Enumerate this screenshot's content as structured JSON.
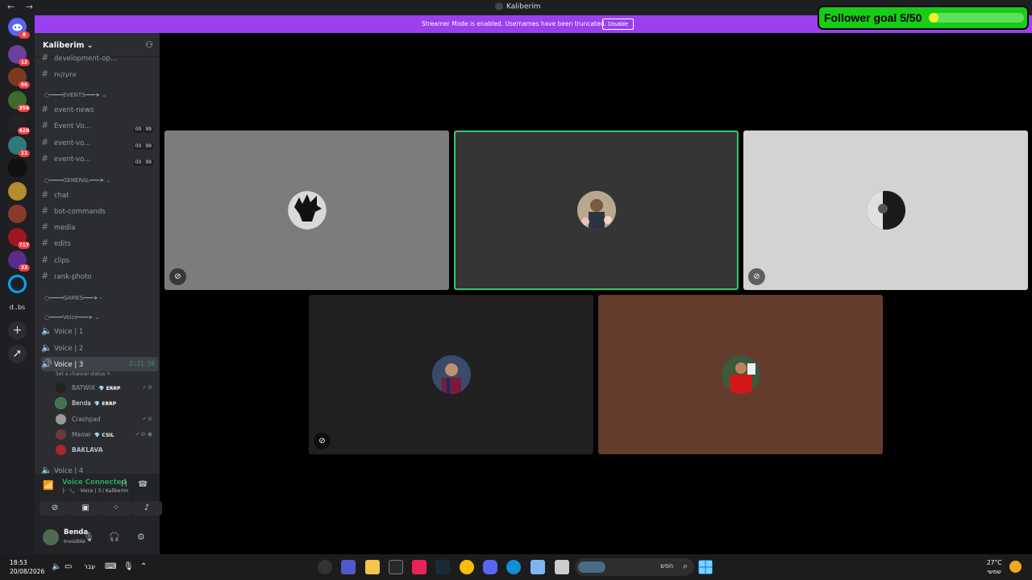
{
  "titlebar": {
    "back": "←",
    "forward": "→",
    "title": "Kaliberim"
  },
  "follower_goal": {
    "label": "Follower goal 5/50",
    "progress": 0.1
  },
  "banner": {
    "message": "Streamer Mode is enabled. Usernames have been truncated.",
    "button": "Disable"
  },
  "servers": {
    "home_badge": "8",
    "badges": [
      "12",
      "96",
      "356",
      "420",
      "11",
      "",
      "",
      "",
      "717",
      "33"
    ],
    "add": "+",
    "explore": "➚",
    "text_server": "d..bs"
  },
  "sidebar": {
    "server_name": "Kaliberim",
    "channels": [
      {
        "name": "development-op...",
        "type": "text"
      },
      {
        "name": "אזעקות",
        "type": "text"
      },
      {
        "name": "event-news",
        "type": "text"
      },
      {
        "name": "Event Vo...",
        "type": "voice",
        "count": [
          "00",
          "99"
        ]
      },
      {
        "name": "event-vo...",
        "type": "voice",
        "count": [
          "00",
          "99"
        ]
      },
      {
        "name": "event-vo...",
        "type": "voice",
        "count": [
          "00",
          "99"
        ]
      },
      {
        "name": "chat",
        "type": "text"
      },
      {
        "name": "bot-commands",
        "type": "text"
      },
      {
        "name": "media",
        "type": "text"
      },
      {
        "name": "edits",
        "type": "text"
      },
      {
        "name": "clips",
        "type": "text"
      },
      {
        "name": "rank-photo",
        "type": "text"
      },
      {
        "name": "Voice | 1",
        "type": "voice"
      },
      {
        "name": "Voice | 2",
        "type": "voice"
      },
      {
        "name": "Voice | 3",
        "type": "voice"
      },
      {
        "name": "Voice | 4",
        "type": "voice"
      }
    ],
    "categories": {
      "events": "○━━━━EVENTS━━━➤ ⌄",
      "general": "○━━━━GENERAL━━━➤ ⌄",
      "games": "○━━━━GAMES━━━➤ ›",
      "voice": "○━━━━Voice━━━➤ ⌄"
    },
    "active_timer": "2:21:56",
    "channel_status": "Set a channel status ✎",
    "members": [
      {
        "name": "BATWIX",
        "tag": "💎 ERRP"
      },
      {
        "name": "Benda",
        "tag": "💎 ERRP"
      },
      {
        "name": "Crashpad",
        "tag": ""
      },
      {
        "name": "Maowi",
        "tag": "💎 CSIL"
      },
      {
        "name": "BAKLAVA",
        "tag": ""
      }
    ]
  },
  "voice_panel": {
    "status": "Voice Connected",
    "location": "├ · 📞 · Voice | 3 / Kaliberim"
  },
  "user_panel": {
    "name": "Benda",
    "status": "Invisible"
  },
  "taskbar": {
    "time": "18:53",
    "date": "20/08/2026",
    "lang": "עבר",
    "search_label": "חפש",
    "temp": "27°C",
    "weather": "שמשי"
  },
  "colors": {
    "banner": "#9b3ff0",
    "follower": "#18cc18",
    "speaking": "#2dc770",
    "brand": "#5865f2"
  }
}
